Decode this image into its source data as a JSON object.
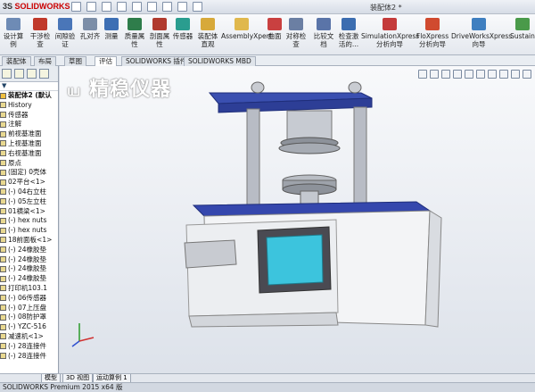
{
  "app": {
    "brand_ds": "3S",
    "brand_name": "SOLIDWORKS",
    "doc_title": "装配体2 *"
  },
  "ribbon": {
    "buttons": [
      {
        "label": "设计算\n例"
      },
      {
        "label": "干涉检\n查"
      },
      {
        "label": "间隙验\n证"
      },
      {
        "label": "孔对齐"
      },
      {
        "label": "测量"
      },
      {
        "label": "质量属\n性"
      },
      {
        "label": "剖面属\n性"
      },
      {
        "label": "传感器"
      },
      {
        "label": "装配体\n直观"
      },
      {
        "label": "AssemblyXpert"
      },
      {
        "label": "曲面"
      },
      {
        "label": "对称检\n查"
      },
      {
        "label": "比较文\n档"
      },
      {
        "label": "检查激\n活的..."
      },
      {
        "label": "SimulationXpress\n分析向导"
      },
      {
        "label": "FloXpress\n分析向导"
      },
      {
        "label": "DriveWorksXpress\n向导"
      },
      {
        "label": "Sustain"
      }
    ]
  },
  "tabs": [
    {
      "label": "装配体"
    },
    {
      "label": "布局"
    },
    {
      "label": "草图"
    },
    {
      "label": "评估"
    },
    {
      "label": "SOLIDWORKS 插件"
    },
    {
      "label": "SOLIDWORKS MBD"
    }
  ],
  "tree": {
    "root": "装配体2 (默认",
    "items": [
      "History",
      "传感器",
      "注解",
      "前视基准面",
      "上视基准面",
      "右视基准面",
      "原点",
      "(固定) 0壳体",
      "02平台<1>",
      "(-) 04右立柱",
      "(-) 05左立柱",
      "01横梁<1>",
      "(-) hex nuts",
      "(-) hex nuts",
      "18前面板<1>",
      "(-) 24橡胶垫",
      "(-) 24橡胶垫",
      "(-) 24橡胶垫",
      "(-) 24橡胶垫",
      "打印机103.1",
      "(-) 06传感器",
      "(-) 07上压盘",
      "(-) 08防护罩",
      "(-) YZC-516",
      "减速机<1>",
      "(-) 28连接件",
      "(-) 28连接件"
    ]
  },
  "watermark": "精稳仪器",
  "bottom_tabs": [
    {
      "label": "模型"
    },
    {
      "label": "3D 视图"
    },
    {
      "label": "运动算例 1"
    }
  ],
  "status": "SOLIDWORKS Premium 2015 x64 版"
}
